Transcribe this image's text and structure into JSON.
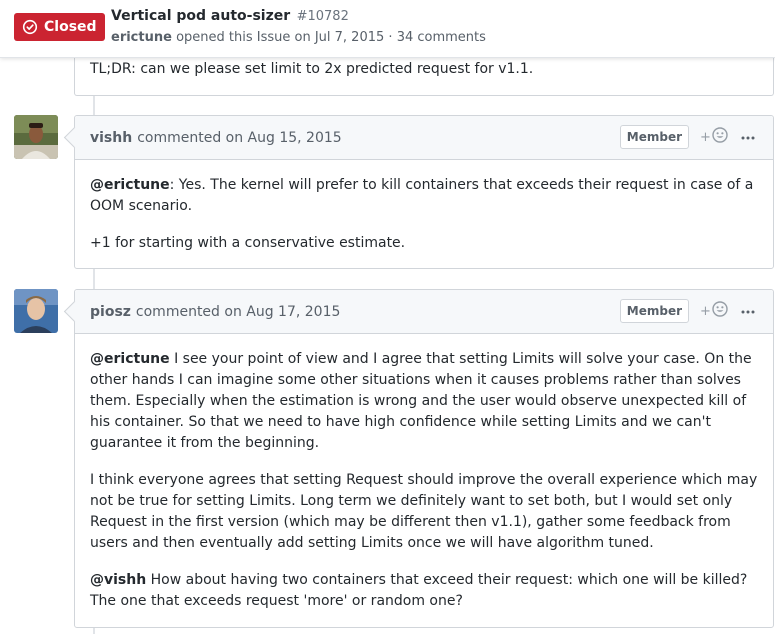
{
  "issue": {
    "state": "Closed",
    "title": "Vertical pod auto-sizer",
    "number": "#10782",
    "author": "erictune",
    "opened_text": "opened this Issue on Jul 7, 2015",
    "separator": "·",
    "comments": "34 comments"
  },
  "partial_comment": {
    "text": "TL;DR: can we please set limit to 2x predicted request for v1.1."
  },
  "comments": [
    {
      "author": "vishh",
      "action": "commented on Aug 15, 2015",
      "badge": "Member",
      "reaction_plus": "+",
      "paragraphs": [
        {
          "mention": "@erictune",
          "text": ": Yes. The kernel will prefer to kill containers that exceeds their request in case of a OOM scenario."
        },
        {
          "mention": "",
          "text": "+1 for starting with a conservative estimate."
        }
      ]
    },
    {
      "author": "piosz",
      "action": "commented on Aug 17, 2015",
      "badge": "Member",
      "reaction_plus": "+",
      "paragraphs": [
        {
          "mention": "@erictune",
          "text": " I see your point of view and I agree that setting Limits will solve your case. On the other hands I can imagine some other situations when it causes problems rather than solves them. Especially when the estimation is wrong and the user would observe unexpected kill of his container. So that we need to have high confidence while setting Limits and we can't guarantee it from the beginning."
        },
        {
          "mention": "",
          "text": "I think everyone agrees that setting Request should improve the overall experience which may not be true for setting Limits. Long term we definitely want to set both, but I would set only Request in the first version (which may be different then v1.1), gather some feedback from users and then eventually add setting Limits once we will have algorithm tuned."
        },
        {
          "mention": "@vishh",
          "text": " How about having two containers that exceed their request: which one will be killed? The one that exceeds request 'more' or random one?"
        }
      ]
    }
  ],
  "colors": {
    "closed_red": "#cb2431",
    "border": "#d1d5da",
    "header_bg": "#f6f8fa",
    "muted_text": "#586069"
  },
  "icons": {
    "state": "closed-issue-icon",
    "reaction": "smiley-icon",
    "more": "kebab-horizontal-icon"
  }
}
